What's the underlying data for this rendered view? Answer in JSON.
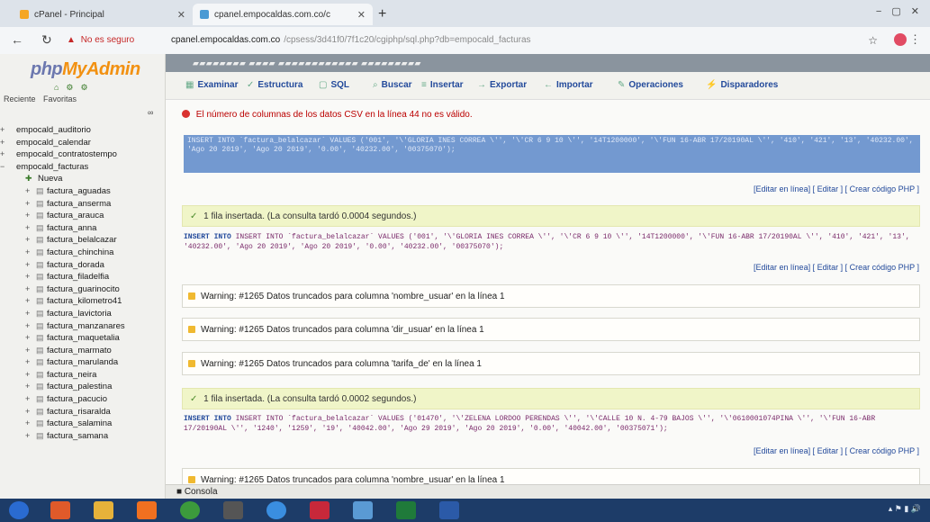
{
  "browser": {
    "tabs": [
      {
        "label": "cPanel - Principal",
        "active": false
      },
      {
        "label": "cpanel.empocaldas.com.co/c",
        "active": true
      }
    ],
    "new_tab": "+",
    "security_warning": "No es seguro",
    "url_host": "cpanel.empocaldas.com.co",
    "url_rest": "/cpsess/3d41f0/7f1c20/cgiphp/sql.php?db=empocald_facturas"
  },
  "sidebar": {
    "logo_php": "php",
    "logo_my": "MyAdmin",
    "tabs": [
      "Reciente",
      "Favoritas"
    ],
    "databases": [
      "empocald_auditorio",
      "empocald_calendar",
      "empocald_contratostempo",
      "empocald_facturas"
    ],
    "new_label": "Nueva",
    "tables": [
      "factura_aguadas",
      "factura_anserma",
      "factura_arauca",
      "factura_anna",
      "factura_belalcazar",
      "factura_chinchina",
      "factura_dorada",
      "factura_filadelfia",
      "factura_guarinocito",
      "factura_kilometro41",
      "factura_lavictoria",
      "factura_manzanares",
      "factura_maquetalia",
      "factura_marmato",
      "factura_marulanda",
      "factura_neira",
      "factura_palestina",
      "factura_pacucio",
      "factura_risaralda",
      "factura_salamina",
      "factura_samana"
    ]
  },
  "main": {
    "menu": [
      {
        "icon": "▦",
        "label": "Examinar"
      },
      {
        "icon": "✓",
        "label": "Estructura"
      },
      {
        "icon": "▢",
        "label": "SQL"
      },
      {
        "icon": "⌕",
        "label": "Buscar"
      },
      {
        "icon": "≡",
        "label": "Insertar"
      },
      {
        "icon": "→",
        "label": "Exportar"
      },
      {
        "icon": "←",
        "label": "Importar"
      },
      {
        "icon": "✎",
        "label": "Operaciones"
      },
      {
        "icon": "⚡",
        "label": "Disparadores"
      }
    ],
    "error_text": "El número de columnas de los datos CSV en la línea 44 no es válido.",
    "success_1": "1 fila insertada. (La consulta tardó 0.0004 segundos.)",
    "success_2": "1 fila insertada. (La consulta tardó 0.0002 segundos.)",
    "query_1": "INSERT INTO `factura_belalcazar` VALUES ('001', '\\'GLORIA INES CORREA \\'', '\\'CR 6 9 10 \\'', '14T1200000', '\\'FUN 16-ABR 17/20190AL \\'', '410', '421', '13', '40232.00', 'Ago 20 2019', 'Ago 20 2019', '0.00', '40232.00', '00375070');",
    "query_2": "INSERT INTO `factura_belalcazar` VALUES ('01470', '\\'ZELENA LORDOO PERENDAS \\'', '\\'CALLE 10 N. 4-79 BAJOS \\'', '\\'0610001074PINA \\'', '\\'FUN 16-ABR 17/20190AL \\'', '1240', '1259', '19', '40042.00', 'Ago 29 2019', 'Ago 20 2019', '0.00', '40042.00', '00375071');",
    "links": [
      "[Editar en línea]",
      "[ Editar ]",
      "[ Crear código PHP ]"
    ],
    "warnings": [
      "Warning: #1265 Datos truncados para columna 'nombre_usuar' en la línea 1",
      "Warning: #1265 Datos truncados para columna 'dir_usuar' en la línea 1",
      "Warning: #1265 Datos truncados para columna 'tarifa_de' en la línea 1",
      "Warning: #1265 Datos truncados para columna 'nombre_usuar' en la línea 1"
    ],
    "console_label": "Consola"
  }
}
